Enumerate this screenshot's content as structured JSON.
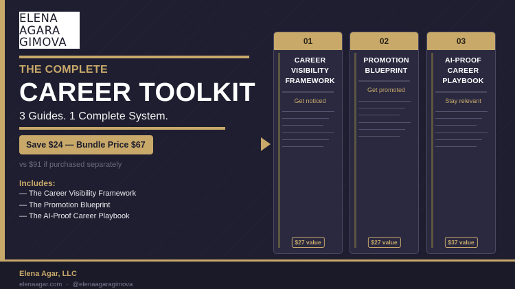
{
  "logo": {
    "lines": [
      "ELENA",
      "AGARA",
      "GIMOVA"
    ]
  },
  "hero": {
    "eyebrow": "THE COMPLETE",
    "title": "CAREER TOOLKIT",
    "subtitle": "3 Guides. 1 Complete System.",
    "bundle_button": "Save $24 — Bundle Price $67",
    "compare_note": "vs $91 if purchased separately"
  },
  "includes": {
    "heading": "Includes:",
    "items": [
      "— The Career Visibility Framework",
      "— The Promotion Blueprint",
      "— The AI-Proof Career Playbook"
    ]
  },
  "cards": [
    {
      "number": "01",
      "title": [
        "CAREER",
        "VISIBILITY",
        "FRAMEWORK"
      ],
      "tagline": "Get noticed",
      "value": "$27 value"
    },
    {
      "number": "02",
      "title": [
        "PROMOTION",
        "BLUEPRINT"
      ],
      "tagline": "Get promoted",
      "value": "$27 value"
    },
    {
      "number": "03",
      "title": [
        "AI-PROOF",
        "CAREER",
        "PLAYBOOK"
      ],
      "tagline": "Stay relevant",
      "value": "$37 value"
    }
  ],
  "footer": {
    "company": "Elena Agar, LLC",
    "website": "elenaagar.com",
    "separator": "·",
    "handle": "@elenaagaragimova"
  },
  "colors": {
    "background": "#1f1e30",
    "accent_gold": "#c8a96a",
    "card": "#2a2940"
  },
  "icons": {
    "arrow": "play-arrow-icon"
  }
}
